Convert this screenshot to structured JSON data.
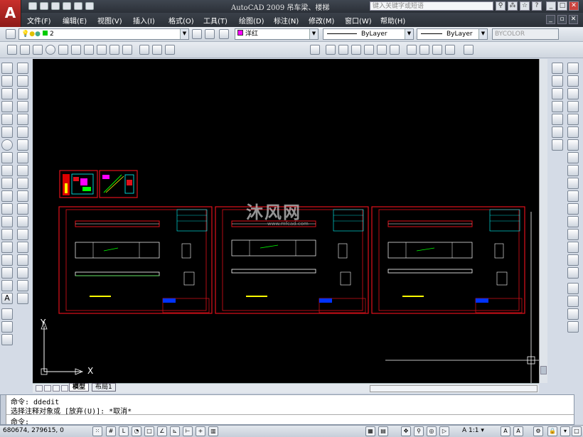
{
  "window": {
    "title": "AutoCAD 2009  吊车梁、楼梯",
    "search_placeholder": "键入关键字或短语",
    "app_logo": "A"
  },
  "menu": {
    "items": [
      "文件(F)",
      "编辑(E)",
      "视图(V)",
      "插入(I)",
      "格式(O)",
      "工具(T)",
      "绘图(D)",
      "标注(N)",
      "修改(M)",
      "窗口(W)",
      "帮助(H)"
    ]
  },
  "layer_toolbar": {
    "layer_value": "2",
    "color_value": "洋红",
    "linetype_value": "ByLayer",
    "lineweight_value": "ByLayer",
    "plotstyle_value": "BYCOLOR"
  },
  "layout_tabs": {
    "model": "模型",
    "layout1": "布局1"
  },
  "command": {
    "line1": "命令:  ddedit",
    "line2": "选择注释对象或 [放弃(U)]: *取消*",
    "prompt": "命令:"
  },
  "status": {
    "coordinates": "680674, 279615, 0",
    "annotation_scale": "1:1"
  },
  "watermark": {
    "text": "沐风网",
    "url": "www.mfcad.com"
  },
  "axis": {
    "x_label": "X",
    "y_label": "Y"
  },
  "colors": {
    "canvas_bg": "#000000",
    "border_red": "#e0101a",
    "ui_chrome": "#d4dbe6",
    "magenta": "#ff00ff",
    "yellow": "#ffff00",
    "cyan": "#00ffff"
  }
}
